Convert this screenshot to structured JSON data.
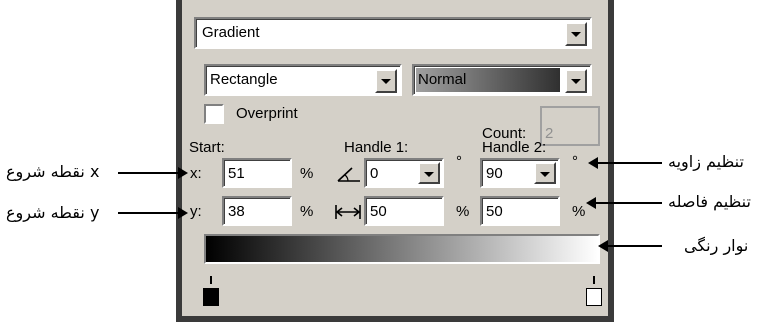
{
  "panel": {
    "fill_type": "Gradient",
    "shape": "Rectangle",
    "blend_mode": "Normal",
    "overprint_label": "Overprint",
    "count_label": "Count:",
    "count_value": "2",
    "start_label": "Start:",
    "handle1_label": "Handle 1:",
    "handle2_label": "Handle 2:",
    "x_label": "x:",
    "y_label": "y:",
    "start_x": "51",
    "start_y": "38",
    "percent": "%",
    "degree": "°",
    "handle1_angle": "0",
    "handle1_distance": "50",
    "handle2_angle": "90",
    "handle2_distance": "50",
    "angle_icon": "angle-icon",
    "distance_icon": "distance-icon",
    "gradient_start_color": "#000000",
    "gradient_end_color": "#ffffff"
  },
  "annotations": {
    "start_x": "x نقطه شروع",
    "start_y": "y نقطه شروع",
    "angle": "تنظیم زاویه",
    "distance": "تنظیم فاصله",
    "color_bar": "نوار رنگی"
  }
}
